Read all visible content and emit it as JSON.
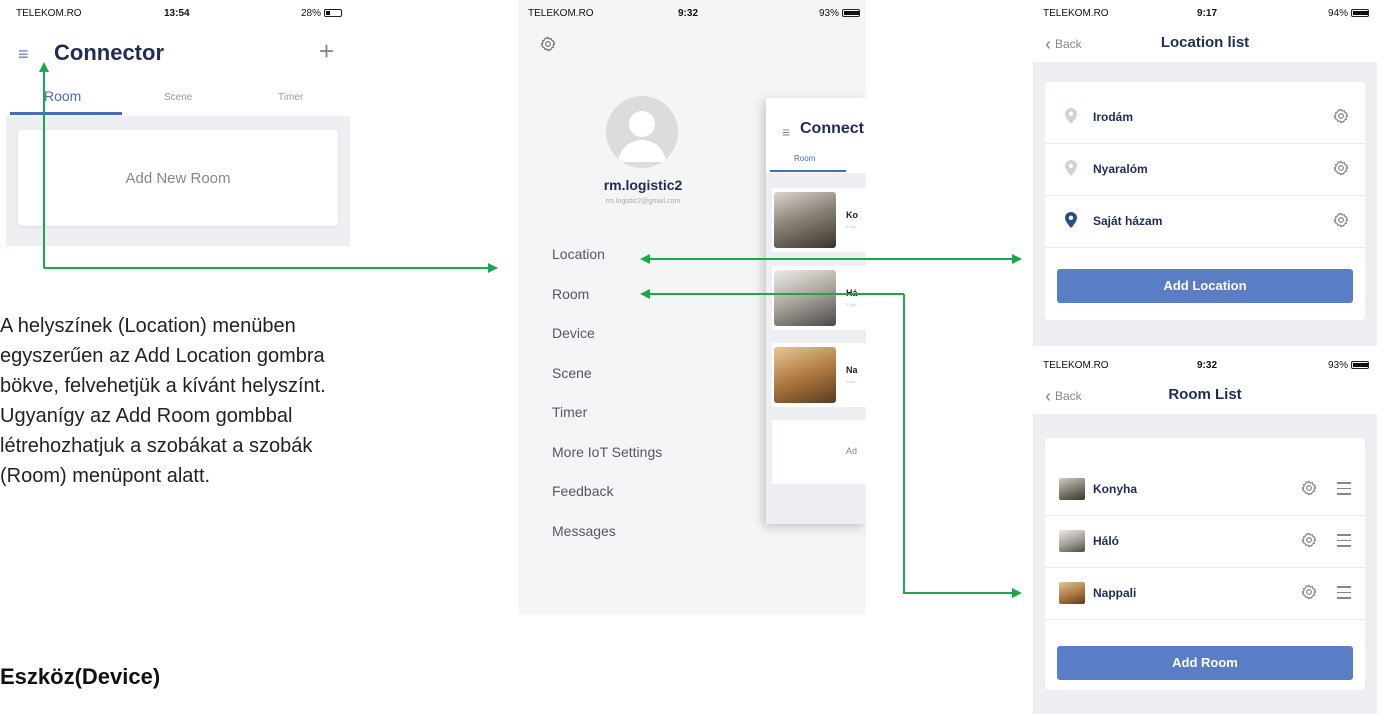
{
  "colors": {
    "accent": "#4a6cb4",
    "button": "#5a7ec6",
    "title": "#1f2d55",
    "arrow": "#1aa84c"
  },
  "panel1": {
    "status": {
      "carrier": "TELEKOM.RO",
      "time": "13:54",
      "battery": "28%",
      "battery_level": 0.28
    },
    "title": "Connector",
    "tabs": [
      "Room",
      "Scene",
      "Timer"
    ],
    "add_room": "Add New Room",
    "icons": {
      "menu": "hamburger-icon",
      "add": "plus-icon"
    }
  },
  "description": [
    "A helyszínek (Location) menüben",
    "egyszerűen az Add Location gombra",
    "bökve, felvehetjük a kívánt helyszínt.",
    "Ugyanígy az Add Room gombbal",
    "létrehozhatjuk a szobákat a szobák",
    "(Room) menüpont alatt."
  ],
  "section_heading": "Eszköz(Device)",
  "panel2": {
    "status": {
      "carrier": "TELEKOM.RO",
      "time": "9:32",
      "battery": "93%",
      "battery_level": 0.93
    },
    "username": "rm.logistic2",
    "email": "rm.logistic2@gmail.com",
    "menu": [
      "Location",
      "Room",
      "Device",
      "Scene",
      "Timer",
      "More IoT Settings",
      "Feedback",
      "Messages"
    ],
    "peek": {
      "title": "Connect",
      "tab": "Room",
      "rooms": [
        "Ko",
        "Há",
        "Na"
      ],
      "room_sub": "0 Dev",
      "add_label": "Ad"
    }
  },
  "panel3": {
    "status": {
      "carrier": "TELEKOM.RO",
      "time": "9:17",
      "battery": "94%",
      "battery_level": 0.94
    },
    "back": "Back",
    "title": "Location list",
    "locations": [
      "Irodám",
      "Nyaralóm",
      "Saját házam"
    ],
    "selected_index": 2,
    "button": "Add Location"
  },
  "panel4": {
    "status": {
      "carrier": "TELEKOM.RO",
      "time": "9:32",
      "battery": "93%",
      "battery_level": 0.93
    },
    "back": "Back",
    "title": "Room List",
    "rooms": [
      "Konyha",
      "Háló",
      "Nappali"
    ],
    "button": "Add Room"
  }
}
